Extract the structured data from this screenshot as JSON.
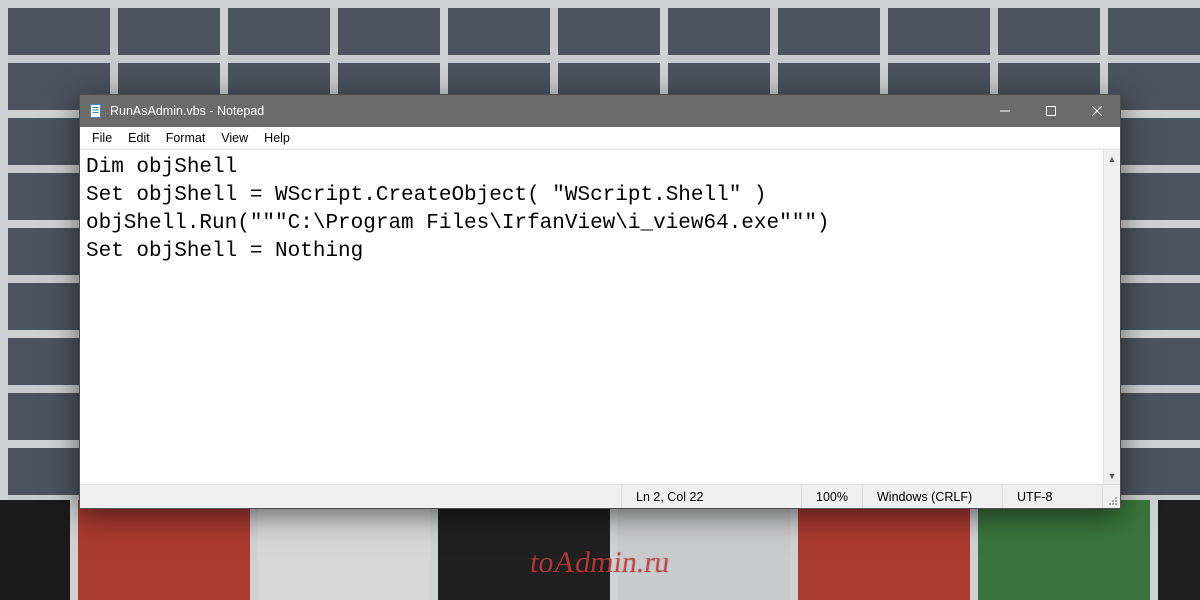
{
  "desktop": {
    "watermark": "toAdmin.ru"
  },
  "window": {
    "title": "RunAsAdmin.vbs - Notepad",
    "menus": {
      "file": "File",
      "edit": "Edit",
      "format": "Format",
      "view": "View",
      "help": "Help"
    },
    "editor": {
      "content": "Dim objShell\nSet objShell = WScript.CreateObject( \"WScript.Shell\" )\nobjShell.Run(\"\"\"C:\\Program Files\\IrfanView\\i_view64.exe\"\"\")\nSet objShell = Nothing"
    },
    "status": {
      "cursor": "Ln 2, Col 22",
      "zoom": "100%",
      "line_ending": "Windows (CRLF)",
      "encoding": "UTF-8"
    }
  }
}
